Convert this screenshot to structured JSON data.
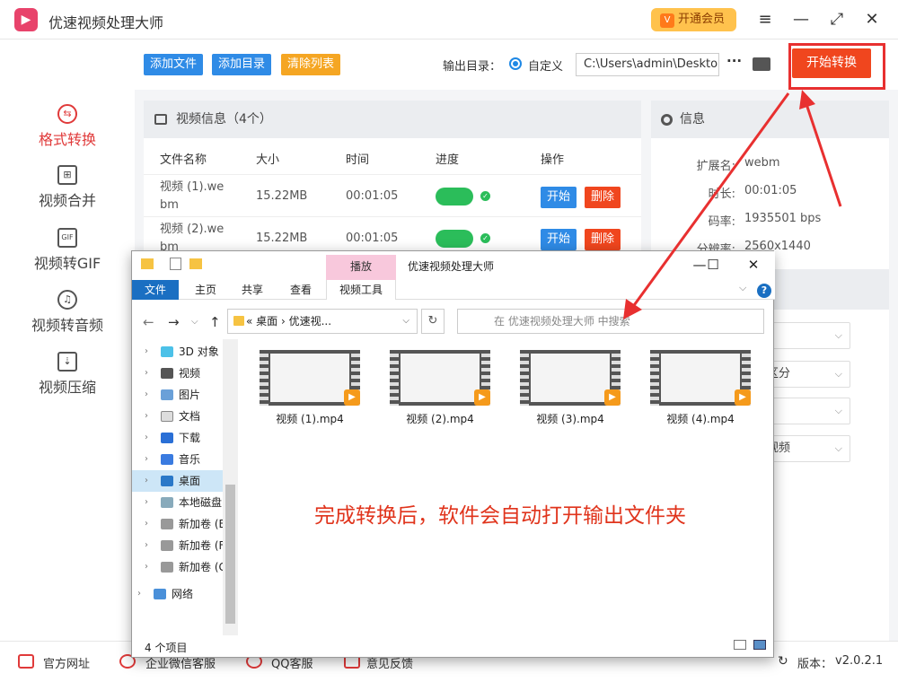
{
  "app": {
    "title": "优速视频处理大师",
    "vip": "开通会员",
    "version_label": "版本：",
    "version": "v2.0.2.1"
  },
  "sidebar": {
    "items": [
      {
        "label": "格式转换",
        "active": true
      },
      {
        "label": "视频合并"
      },
      {
        "label": "视频转GIF"
      },
      {
        "label": "视频转音频"
      },
      {
        "label": "视频压缩"
      }
    ]
  },
  "toolbar": {
    "add_file": "添加文件",
    "add_dir": "添加目录",
    "clear_list": "清除列表",
    "output_label": "输出目录：",
    "custom_label": "自定义",
    "path": "C:\\Users\\admin\\Desktop",
    "start": "开始转换"
  },
  "video_panel": {
    "title": "视频信息（4个）",
    "columns": [
      "文件名称",
      "大小",
      "时间",
      "进度",
      "操作"
    ],
    "rows": [
      {
        "name": "视频 (1).we bm",
        "size": "15.22MB",
        "time": "00:01:05"
      },
      {
        "name": "视频 (2).we bm",
        "size": "15.22MB",
        "time": "00:01:05"
      }
    ],
    "start_label": "开始",
    "delete_label": "删除"
  },
  "info_panel": {
    "title": "信息",
    "ext_key": "扩展名:",
    "ext": "webm",
    "dur_key": "时长:",
    "dur": "00:01:05",
    "rate_key": "码率:",
    "rate": "1935501 bps",
    "res_key": "分辨率:",
    "res": "2560x1440",
    "options": [
      "区分",
      "视频"
    ]
  },
  "footer": {
    "links": [
      "官方网址",
      "企业微信客服",
      "QQ客服",
      "意见反馈"
    ]
  },
  "explorer": {
    "play_tab": "播放",
    "title": "优速视频处理大师",
    "tabs": [
      "文件",
      "主页",
      "共享",
      "查看",
      "视频工具"
    ],
    "breadcrumb": "«  桌面 › 优速视...",
    "search_placeholder": "在 优速视频处理大师 中搜索",
    "tree": [
      "3D 对象",
      "视频",
      "图片",
      "文档",
      "下载",
      "音乐",
      "桌面",
      "本地磁盘",
      "新加卷 (E",
      "新加卷 (F",
      "新加卷 (G",
      "网络"
    ],
    "files": [
      "视频 (1).mp4",
      "视频 (2).mp4",
      "视频 (3).mp4",
      "视频 (4).mp4"
    ],
    "message": "完成转换后，软件会自动打开输出文件夹",
    "status": "4 个项目"
  }
}
